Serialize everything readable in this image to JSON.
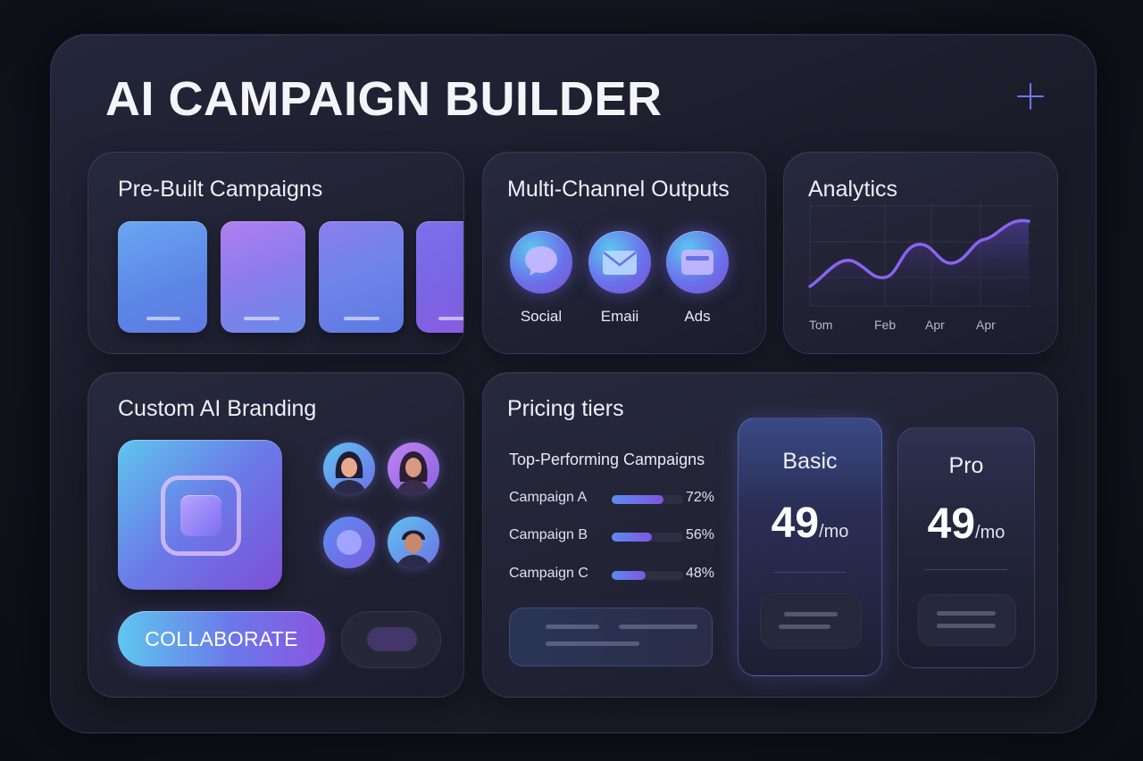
{
  "header": {
    "title": "AI CAMPAIGN BUILDER"
  },
  "prebuilt": {
    "title": "Pre-Built Campaigns"
  },
  "channels": {
    "title": "Multi-Channel Outputs",
    "items": [
      {
        "label": "Social",
        "icon": "chat-bubble-icon"
      },
      {
        "label": "Emaii",
        "icon": "envelope-icon"
      },
      {
        "label": "Ads",
        "icon": "ad-window-icon"
      }
    ]
  },
  "analytics": {
    "title": "Analytics",
    "x_labels": [
      "Tom",
      "Feb",
      "Apr",
      "Apr"
    ],
    "line_color": "#8a63f0"
  },
  "branding": {
    "title": "Custom AI Branding",
    "collaborate_label": "COLLABORATE"
  },
  "pricing": {
    "title": "Pricing tiers",
    "top_title": "Top-Performing Campaigns",
    "campaigns": [
      {
        "name": "Campaign A",
        "percent_label": "72%",
        "percent": 72
      },
      {
        "name": "Campaign B",
        "percent_label": "56%",
        "percent": 56
      },
      {
        "name": "Campaign C",
        "percent_label": "48%",
        "percent": 48
      }
    ],
    "tiers": [
      {
        "name": "Basic",
        "price": "49",
        "per": "/mo"
      },
      {
        "name": "Pro",
        "price": "49",
        "per": "/mo"
      }
    ]
  },
  "colors": {
    "accent": "#6f78f0",
    "gradient_start": "#5fc6ee",
    "gradient_end": "#8a55e0",
    "background": "#12131c"
  }
}
